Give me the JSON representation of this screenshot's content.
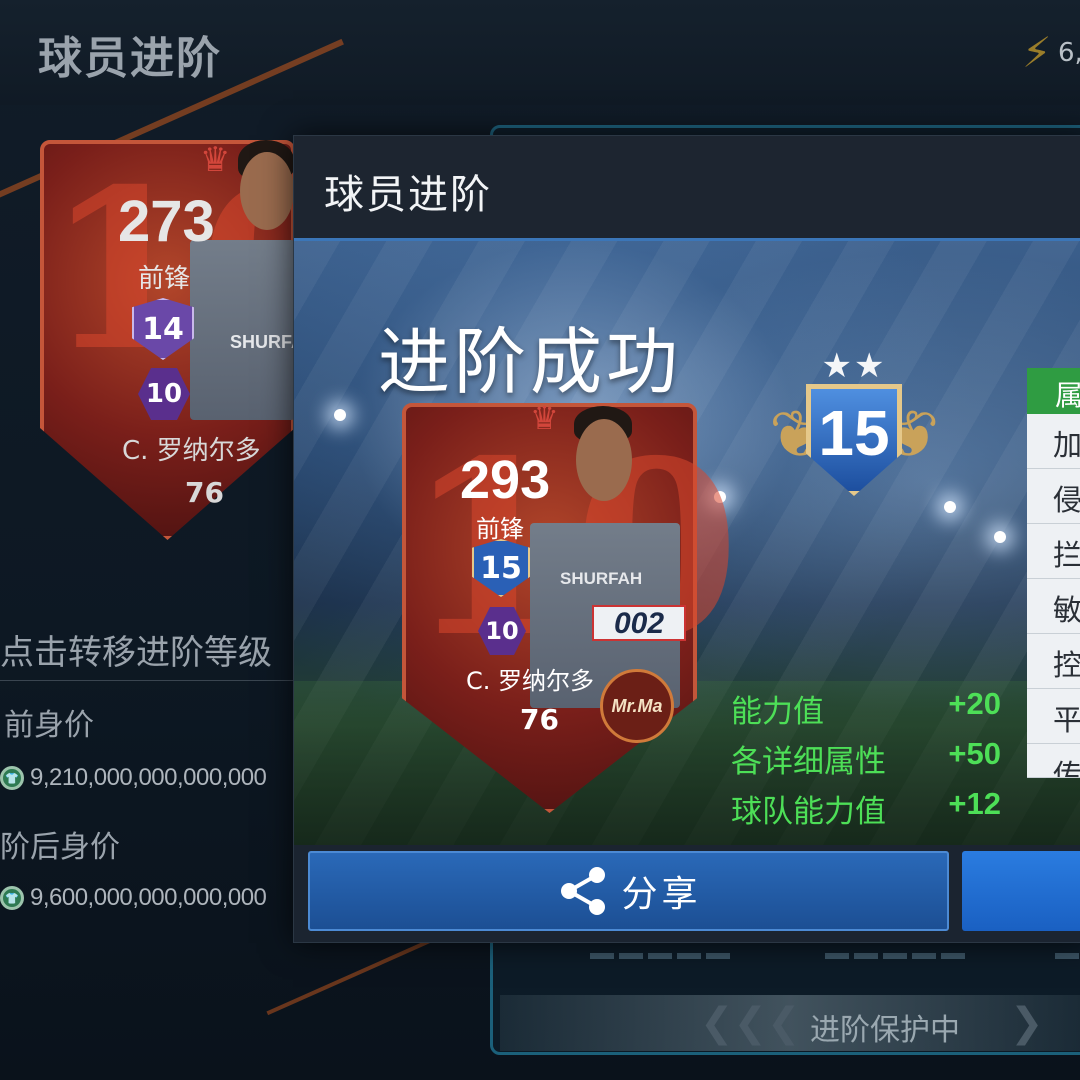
{
  "background": {
    "title": "球员进阶",
    "currency_partial": "6,",
    "card": {
      "rating": "273",
      "position": "前锋",
      "upgrade_level": "14",
      "hex_level": "10",
      "sponsor": "SHURFA",
      "name": "C. 罗纳尔多",
      "team_rating": "76"
    },
    "hint": "点击转移进阶等级",
    "before_label": "前身价",
    "before_value": "9,210,000,000,000,000",
    "after_label": "阶后身价",
    "after_value": "9,600,000,000,000,000",
    "protect_label": "进阶保护中"
  },
  "modal": {
    "title": "球员进阶",
    "success_text": "进阶成功",
    "level_stars": "★★",
    "level": "15",
    "card": {
      "rating": "293",
      "position": "前锋",
      "upgrade_level": "15",
      "hex_level": "10",
      "sponsor": "SHURFAH",
      "jersey_number": "002",
      "name": "C. 罗纳尔多",
      "team_rating": "76",
      "creator_badge": "Mr.Ma"
    },
    "stats": [
      {
        "label": "能力值",
        "value": "+20"
      },
      {
        "label": "各详细属性",
        "value": "+50"
      },
      {
        "label": "球队能力值",
        "value": "+12"
      }
    ],
    "attribute_panel": {
      "header": "属",
      "items": [
        "加",
        "侵",
        "拦",
        "敏",
        "控",
        "平",
        "传"
      ]
    },
    "share_label": "分享"
  },
  "colors": {
    "accent_green": "#4ddf57",
    "button_blue": "#2a69b8",
    "card_red": "#b2462a"
  }
}
